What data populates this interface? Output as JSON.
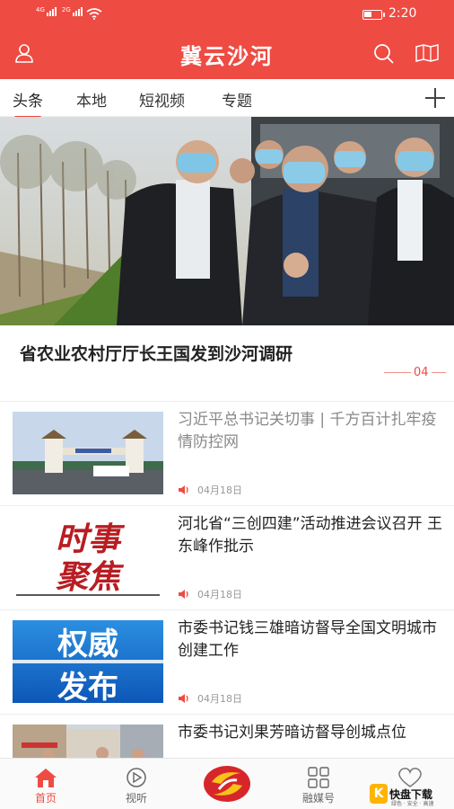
{
  "status_bar": {
    "network_1": "4G",
    "network_2": "2G",
    "time": "2:20",
    "battery_level": 0.45
  },
  "header": {
    "title": "冀云沙河"
  },
  "tabs": [
    {
      "label": "头条",
      "active": true
    },
    {
      "label": "本地"
    },
    {
      "label": "短视频"
    },
    {
      "label": "专题"
    }
  ],
  "hero": {
    "headline": "省农业农村厅厅长王国发到沙河调研",
    "page_indicator": "04"
  },
  "news": [
    {
      "title": "习近平总书记关切事 | 千方百计扎牢疫情防控网",
      "date": "04月18日",
      "read": true,
      "thumb": "checkpoint-gate"
    },
    {
      "title": "河北省“三创四建”活动推进会议召开 王东峰作批示",
      "date": "04月18日",
      "read": false,
      "thumb": "shishi-jujiao",
      "thumb_text": [
        "时事",
        "聚焦"
      ]
    },
    {
      "title": "市委书记钱三雄暗访督导全国文明城市创建工作",
      "date": "04月18日",
      "read": false,
      "thumb": "quanwei-fabu",
      "thumb_text": [
        "权威",
        "发布"
      ]
    },
    {
      "title": "市委书记刘果芳暗访督导创城点位",
      "date": "",
      "read": false,
      "thumb": "street"
    }
  ],
  "bottom_nav": [
    {
      "label": "首页",
      "icon": "home-icon",
      "active": true
    },
    {
      "label": "视听",
      "icon": "play-icon"
    },
    {
      "label": "",
      "icon": "center-logo"
    },
    {
      "label": "融媒号",
      "icon": "grid-icon"
    },
    {
      "label": "",
      "icon": "heart-icon"
    }
  ],
  "watermark": {
    "badge": "K",
    "text": "快盘下载",
    "sub": "绿色 · 安全 · 高速"
  },
  "colors": {
    "accent": "#ee4b43",
    "text": "#222222",
    "muted": "#999999"
  }
}
